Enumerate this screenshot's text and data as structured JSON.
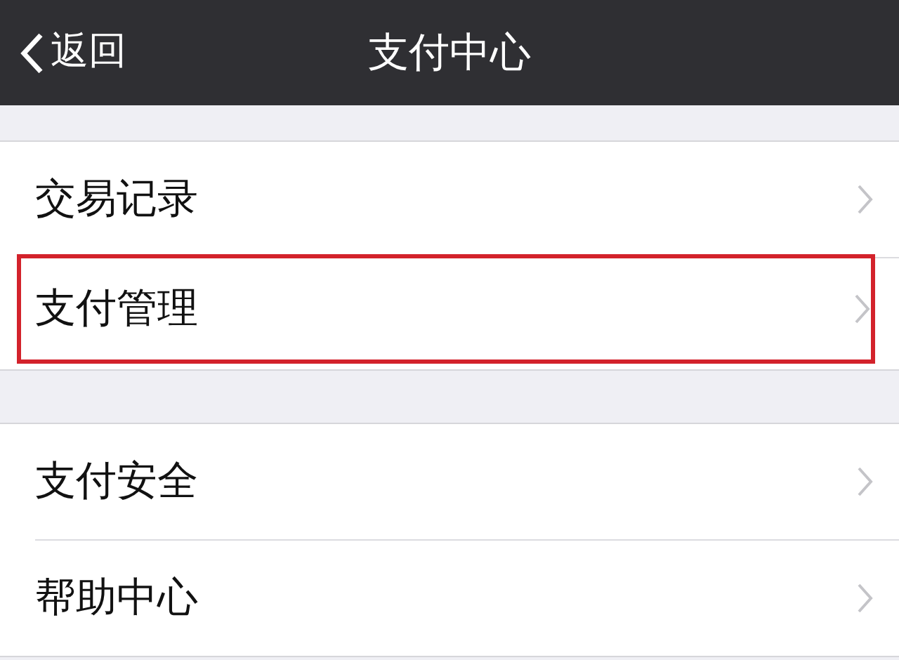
{
  "header": {
    "back_label": "返回",
    "title": "支付中心"
  },
  "groups": [
    {
      "items": [
        {
          "label": "交易记录",
          "highlighted": false
        },
        {
          "label": "支付管理",
          "highlighted": true
        }
      ]
    },
    {
      "items": [
        {
          "label": "支付安全",
          "highlighted": false
        },
        {
          "label": "帮助中心",
          "highlighted": false
        }
      ]
    }
  ]
}
